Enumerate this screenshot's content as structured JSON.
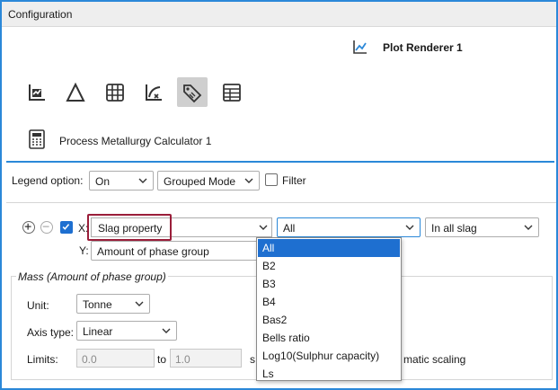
{
  "window": {
    "title": "Configuration"
  },
  "header": {
    "renderer_label": "Plot Renderer 1",
    "renderer_icon": "line-chart-icon"
  },
  "toolbar": {
    "buttons": [
      {
        "icon": "axis-chart-icon"
      },
      {
        "icon": "triangle-icon"
      },
      {
        "icon": "grid-icon"
      },
      {
        "icon": "curve-axis-icon"
      },
      {
        "icon": "tag-icon",
        "selected": true
      },
      {
        "icon": "table-icon"
      }
    ]
  },
  "calculator_tab": {
    "label": "Process Metallurgy Calculator 1",
    "icon": "calculator-icon"
  },
  "legend": {
    "label": "Legend option:",
    "option_value": "On",
    "mode_value": "Grouped Mode",
    "filter_label": "Filter"
  },
  "axes": {
    "x_label": "X:",
    "x_value": "Slag property",
    "x_filter_value": "All",
    "x_scope_value": "In all slag",
    "y_label": "Y:",
    "y_value": "Amount of phase group"
  },
  "mass_group": {
    "title": "Mass (Amount of phase group)",
    "unit_label": "Unit:",
    "unit_value": "Tonne",
    "axis_type_label": "Axis type:",
    "axis_type_value": "Linear",
    "limits_label": "Limits:",
    "limit_min": "0.0",
    "to_label": "to",
    "limit_max": "1.0",
    "step_fragment": "s",
    "auto_scaling_fragment": "matic scaling"
  },
  "dropdown": {
    "items": [
      "All",
      "B2",
      "B3",
      "B4",
      "Bas2",
      "Bells ratio",
      "Log10(Sulphur capacity)",
      "Ls"
    ],
    "selected_index": 0
  },
  "colors": {
    "accent": "#2b88d8",
    "selection": "#1e6fd0",
    "highlight": "#9a1e3a"
  }
}
